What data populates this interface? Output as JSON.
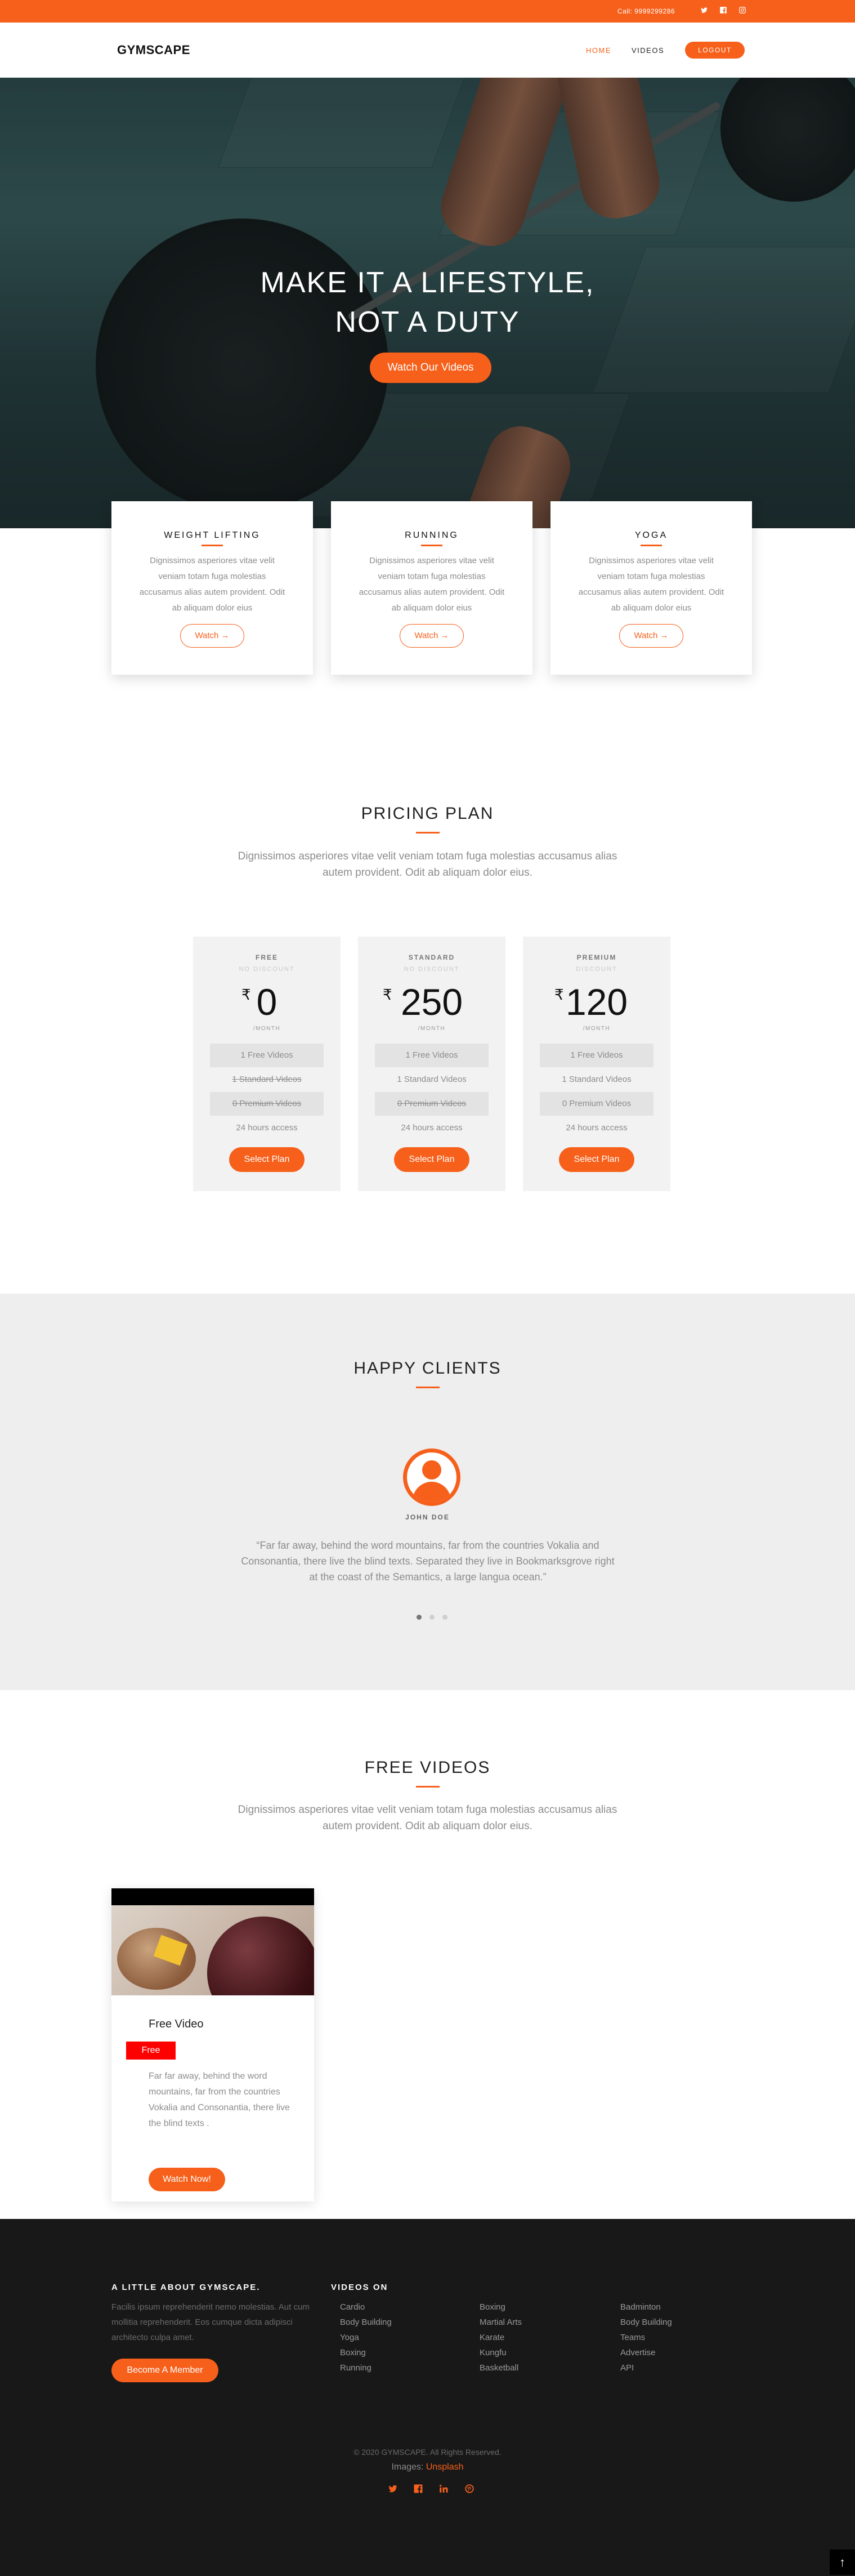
{
  "topbar": {
    "call": "Call: 9999299286",
    "icons": [
      "twitter-icon",
      "facebook-icon",
      "instagram-icon"
    ]
  },
  "nav": {
    "logo": "GYMSCAPE",
    "logo_dot": ".",
    "home": "HOME",
    "videos": "VIDEOS",
    "logout": "LOGOUT"
  },
  "hero": {
    "line1": "MAKE IT A LIFESTYLE,",
    "line2": "NOT A DUTY",
    "cta": "Watch Our Videos"
  },
  "activities": [
    {
      "title": "WEIGHT LIFTING",
      "desc": "Dignissimos asperiores vitae velit veniam totam fuga molestias accusamus alias autem provident. Odit ab aliquam dolor eius",
      "button": "Watch →"
    },
    {
      "title": "RUNNING",
      "desc": "Dignissimos asperiores vitae velit veniam totam fuga molestias accusamus alias autem provident. Odit ab aliquam dolor eius",
      "button": "Watch →"
    },
    {
      "title": "YOGA",
      "desc": "Dignissimos asperiores vitae velit veniam totam fuga molestias accusamus alias autem provident. Odit ab aliquam dolor eius",
      "button": "Watch →"
    }
  ],
  "pricing": {
    "title": "PRICING PLAN",
    "subtitle": "Dignissimos asperiores vitae velit veniam totam fuga molestias accusamus alias autem provident. Odit ab aliquam dolor eius.",
    "currency": "₹",
    "plans": [
      {
        "name": "FREE",
        "discount": "NO DISCOUNT",
        "amount": "0",
        "period": "/MONTH",
        "f1": "1 Free Videos",
        "f2": "1 Standard Videos",
        "f3": "0 Premium Videos",
        "f4": "24 hours access",
        "button": "Select Plan"
      },
      {
        "name": "STANDARD",
        "discount": "NO DISCOUNT",
        "amount": "250",
        "period": "/MONTH",
        "f1": "1 Free Videos",
        "f2": "1 Standard Videos",
        "f3": "0 Premium Videos",
        "f4": "24 hours access",
        "button": "Select Plan"
      },
      {
        "name": "PREMIUM",
        "discount": "DISCOUNT",
        "amount": "120",
        "period": "/MONTH",
        "f1": "1 Free Videos",
        "f2": "1 Standard Videos",
        "f3": "0 Premium Videos",
        "f4": "24 hours access",
        "button": "Select Plan"
      }
    ]
  },
  "clients": {
    "title": "HAPPY CLIENTS",
    "name": "JOHN DOE",
    "quote": "“Far far away, behind the word mountains, far from the countries Vokalia and Consonantia, there live the blind texts. Separated they live in Bookmarksgrove right at the coast of the Semantics, a large langua ocean.”",
    "slides": 3,
    "active_slide": 1
  },
  "free_videos": {
    "title": "FREE VIDEOS",
    "subtitle": "Dignissimos asperiores vitae velit veniam totam fuga molestias accusamus alias autem provident. Odit ab aliquam dolor eius.",
    "card": {
      "title": "Free Video",
      "badge": "Free",
      "desc": "Far far away, behind the word mountains, far from the countries Vokalia and Consonantia, there live the blind texts .",
      "button": "Watch Now!"
    }
  },
  "footer": {
    "about_title": "A LITTLE ABOUT GYMSCAPE.",
    "about_text": "Facilis ipsum reprehenderit nemo molestias. Aut cum mollitia reprehenderit. Eos cumque dicta adipisci architecto culpa amet.",
    "member_button": "Become A Member",
    "videos_title": "VIDEOS ON",
    "col1": [
      "Cardio",
      "Body Building",
      "Yoga",
      "Boxing",
      "Running"
    ],
    "col2": [
      "Boxing",
      "Martial Arts",
      "Karate",
      "Kungfu",
      "Basketball"
    ],
    "col3": [
      "Badminton",
      "Body Building",
      "Teams",
      "Advertise",
      "API"
    ],
    "copyright": "© 2020 GYMSCAPE. All Rights Reserved.",
    "images_label": "Images:",
    "images_source": "Unsplash",
    "social_icons": [
      "twitter-icon",
      "facebook-icon",
      "linkedin-icon",
      "pinterest-icon"
    ],
    "to_top": "↑"
  },
  "colors": {
    "accent": "#f6601b",
    "badge": "#ff0000",
    "footer_bg": "#181818",
    "section_bg": "#eeeeee"
  }
}
